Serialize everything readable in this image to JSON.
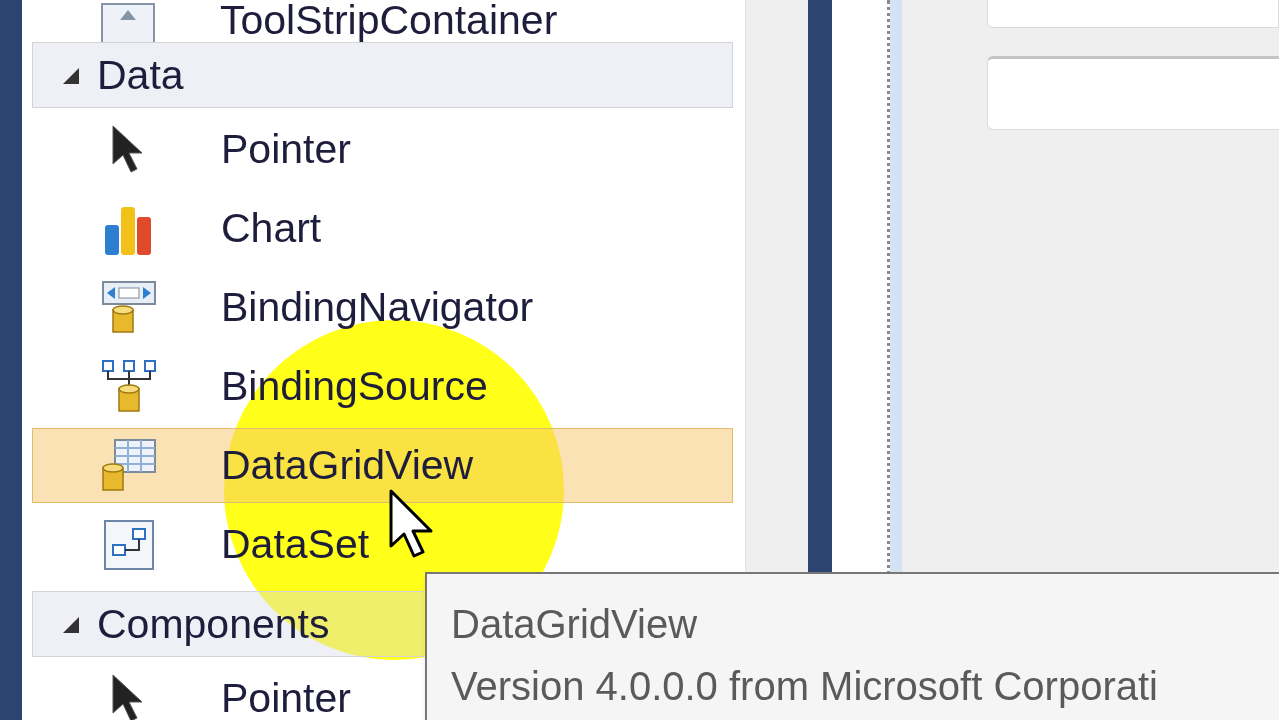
{
  "toolbox": {
    "top_item": {
      "label": "ToolStripContainer",
      "kind": "toolstrip"
    },
    "categories": [
      {
        "label": "Data",
        "expanded": true,
        "items": [
          {
            "label": "Pointer",
            "kind": "pointer",
            "selected": false
          },
          {
            "label": "Chart",
            "kind": "chart",
            "selected": false
          },
          {
            "label": "BindingNavigator",
            "kind": "navigator",
            "selected": false
          },
          {
            "label": "BindingSource",
            "kind": "source",
            "selected": false
          },
          {
            "label": "DataGridView",
            "kind": "grid",
            "selected": true
          },
          {
            "label": "DataSet",
            "kind": "dataset",
            "selected": false
          }
        ]
      },
      {
        "label": "Components",
        "expanded": true,
        "items": [
          {
            "label": "Pointer",
            "kind": "pointer",
            "selected": false
          }
        ]
      }
    ]
  },
  "tooltip": {
    "title": "DataGridView",
    "description": "Version 4.0.0.0 from Microsoft Corporati"
  }
}
